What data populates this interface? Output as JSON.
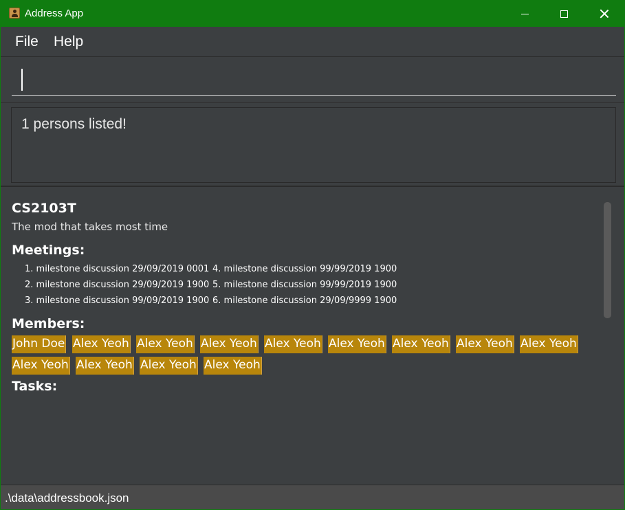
{
  "window": {
    "title": "Address App"
  },
  "menu": {
    "file": "File",
    "help": "Help"
  },
  "command": {
    "value": ""
  },
  "result": {
    "text": "1 persons listed!"
  },
  "project": {
    "name": "CS2103T",
    "description": "The mod that takes most time",
    "meetings_label": "Meetings:",
    "meetings": [
      "1. milestone discussion 29/09/2019 0001",
      "2. milestone discussion 29/09/2019 1900",
      "3. milestone discussion 99/09/2019 1900",
      "4. milestone discussion 99/99/2019 1900",
      "5. milestone discussion 99/99/2019 1900",
      "6. milestone discussion 29/09/9999 1900"
    ],
    "members_label": "Members:",
    "members": [
      "John Doe",
      "Alex Yeoh",
      "Alex Yeoh",
      "Alex Yeoh",
      "Alex Yeoh",
      "Alex Yeoh",
      "Alex Yeoh",
      "Alex Yeoh",
      "Alex Yeoh",
      "Alex Yeoh",
      "Alex Yeoh",
      "Alex Yeoh",
      "Alex Yeoh"
    ],
    "tasks_label": "Tasks:"
  },
  "status": {
    "path": ".\\data\\addressbook.json"
  },
  "colors": {
    "titlebar": "#107c10",
    "background": "#3c3f41",
    "tag": "#b8860b"
  }
}
